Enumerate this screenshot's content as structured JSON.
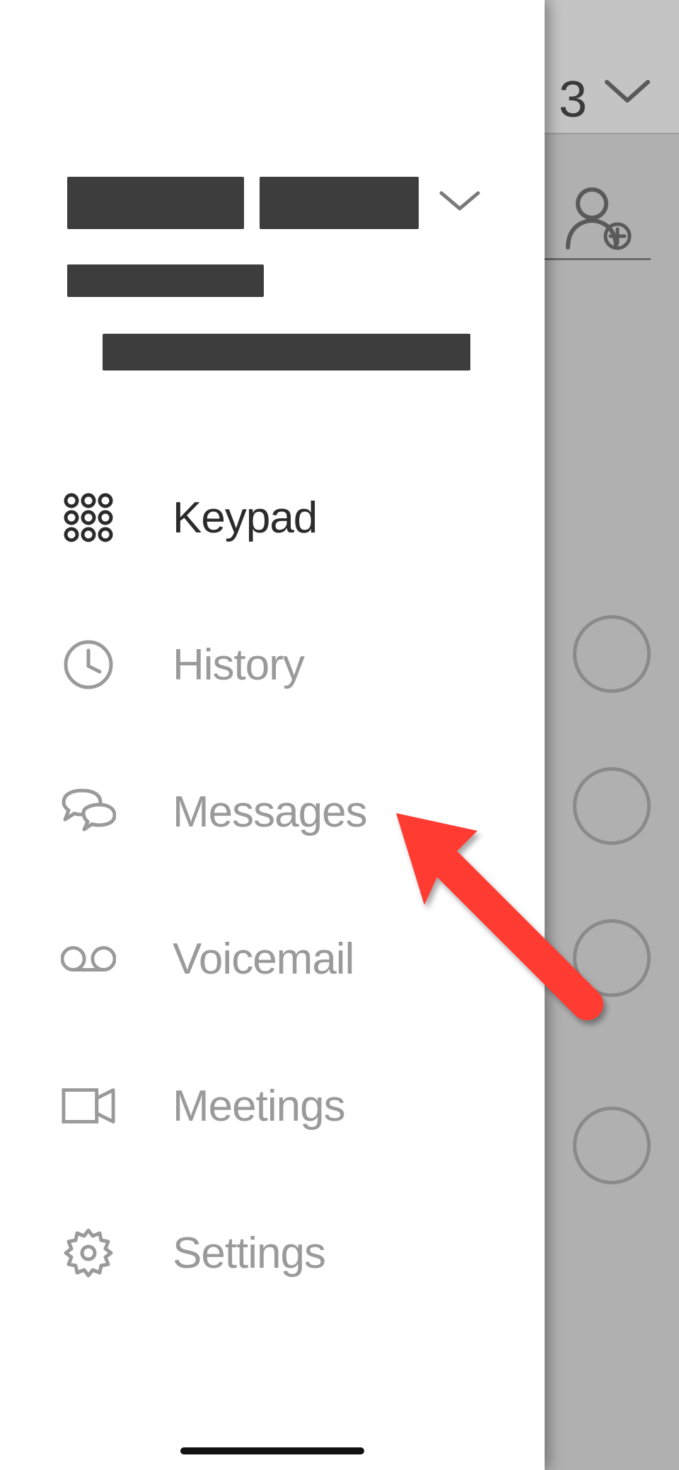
{
  "backdrop": {
    "header_text": "3"
  },
  "menu": {
    "items": [
      {
        "id": "keypad",
        "label": "Keypad",
        "active": true
      },
      {
        "id": "history",
        "label": "History",
        "active": false
      },
      {
        "id": "messages",
        "label": "Messages",
        "active": false
      },
      {
        "id": "voicemail",
        "label": "Voicemail",
        "active": false
      },
      {
        "id": "meetings",
        "label": "Meetings",
        "active": false
      },
      {
        "id": "settings",
        "label": "Settings",
        "active": false
      }
    ]
  },
  "annotation": {
    "arrow_color": "#ff3b30",
    "target": "messages"
  }
}
